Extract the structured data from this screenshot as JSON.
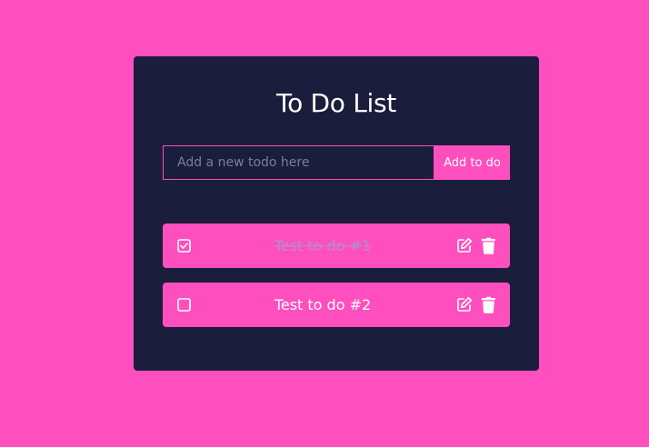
{
  "app": {
    "title": "To Do List"
  },
  "add_form": {
    "input_value": "",
    "placeholder": "Add a new todo here",
    "button_label": "Add to do"
  },
  "todos": [
    {
      "text": "Test to do #1",
      "completed": true
    },
    {
      "text": "Test to do #2",
      "completed": false
    }
  ],
  "icons": {
    "checkbox_checked": "checkbox-checked-icon",
    "checkbox_empty": "checkbox-empty-icon",
    "edit": "edit-icon",
    "delete": "trash-icon"
  },
  "colors": {
    "background": "#ff4fbf",
    "card": "#1a1d3b",
    "accent": "#ff4fbf",
    "text": "#ffffff",
    "completed_text": "#b68cd4",
    "placeholder": "#7c7f93"
  }
}
